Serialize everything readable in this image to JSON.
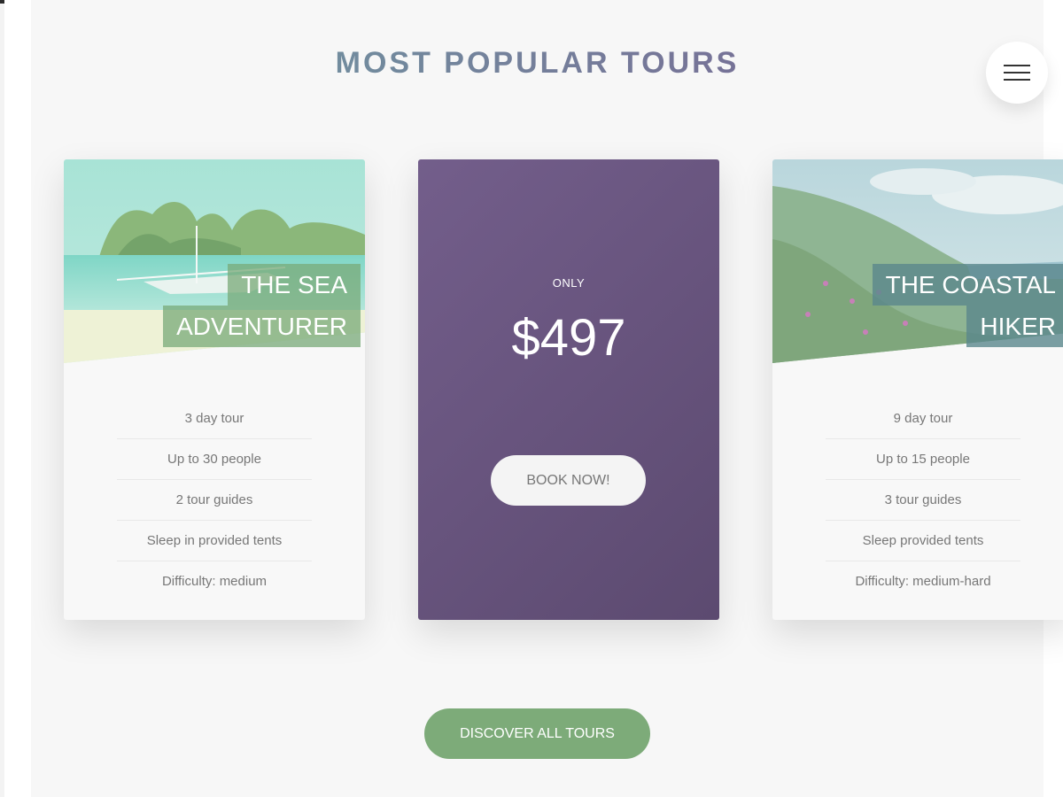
{
  "section": {
    "title": "MOST POPULAR TOURS"
  },
  "menu": {
    "icon": "hamburger-menu-icon"
  },
  "tours": [
    {
      "heading_line1": "THE SEA",
      "heading_line2": "ADVENTURER",
      "image": "tropical-beach-boat-photo",
      "details": [
        "3 day tour",
        "Up to 30 people",
        "2 tour guides",
        "Sleep in provided tents",
        "Difficulty: medium"
      ]
    },
    {
      "heading_line1": "THE COASTAL",
      "heading_line2": "HIKER",
      "image": "coastal-mountain-meadow-photo",
      "details": [
        "9 day tour",
        "Up to 15 people",
        "3 tour guides",
        "Sleep provided tents",
        "Difficulty: medium-hard"
      ]
    }
  ],
  "price_card": {
    "only_label": "ONLY",
    "price": "$497",
    "book_label": "BOOK NOW!"
  },
  "cta": {
    "discover_label": "DISCOVER ALL TOURS"
  },
  "colors": {
    "title_gradient_start": "#6e9fa3",
    "title_gradient_end": "#7a5f92",
    "price_card": "#6a5580",
    "green_accent": "#7dab79",
    "teal_accent": "#5a878c"
  }
}
